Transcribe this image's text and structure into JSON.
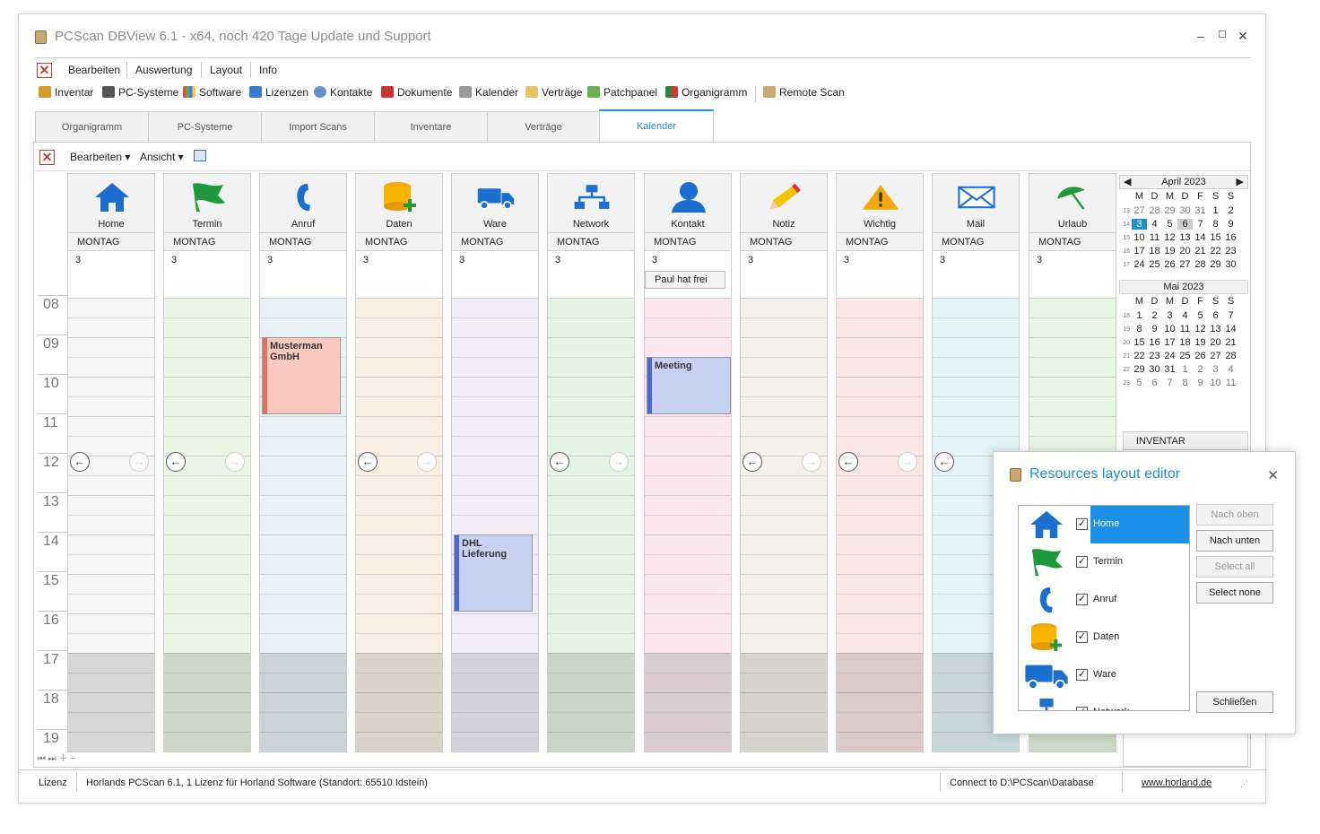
{
  "window": {
    "title": "PCScan DBView 6.1 - x64, noch 420 Tage Update und Support"
  },
  "menu": [
    "Bearbeiten",
    "Auswertung",
    "Layout",
    "Info"
  ],
  "toolbar": [
    "Inventar",
    "PC-Systeme",
    "Software",
    "Lizenzen",
    "Kontakte",
    "Dokumente",
    "Kalender",
    "Verträge",
    "Patchpanel",
    "Organigramm",
    "Remote Scan"
  ],
  "tabs": [
    "Organigramm",
    "PC-Systeme",
    "Import Scans",
    "Inventare",
    "Verträge",
    "Kalender"
  ],
  "subtoolbar": {
    "edit": "Bearbeiten ▾",
    "view": "Ansicht ▾"
  },
  "calendar": {
    "day_name": "MONTAG",
    "day_number": "3",
    "hours": [
      "08",
      "09",
      "10",
      "11",
      "12",
      "13",
      "14",
      "15",
      "16",
      "17",
      "18",
      "19"
    ],
    "resources": [
      {
        "name": "Home",
        "color": "#f5f5f5",
        "icon": "home-icon"
      },
      {
        "name": "Termin",
        "color": "#eaf5e4",
        "icon": "flag-icon"
      },
      {
        "name": "Anruf",
        "color": "#e6f2f6",
        "icon": "phone-icon"
      },
      {
        "name": "Daten",
        "color": "#fbeee2",
        "icon": "database-add-icon"
      },
      {
        "name": "Ware",
        "color": "#f1eefa",
        "icon": "truck-icon"
      },
      {
        "name": "Network",
        "color": "#e4f4e4",
        "icon": "network-icon"
      },
      {
        "name": "Kontakt",
        "color": "#fbe6ee",
        "icon": "contact-icon"
      },
      {
        "name": "Notiz",
        "color": "#f4f0ea",
        "icon": "pencil-icon"
      },
      {
        "name": "Wichtig",
        "color": "#fbe6e6",
        "icon": "warning-icon"
      },
      {
        "name": "Mail",
        "color": "#e2f4f8",
        "icon": "mail-icon"
      },
      {
        "name": "Urlaub",
        "color": "#e6f6e2",
        "icon": "umbrella-icon"
      }
    ],
    "allday_event": "Paul hat frei",
    "appointments": [
      {
        "title": "Musterman GmbH",
        "resource": "Anruf",
        "start": "09:00",
        "end": "11:00",
        "color": "#f9c9c0",
        "bar": "#e07060"
      },
      {
        "title": "Meeting",
        "resource": "Kontakt",
        "start": "09:30",
        "end": "11:00",
        "color": "#c7d2f2",
        "bar": "#4a68d0"
      },
      {
        "title": "DHL Lieferung",
        "resource": "Ware",
        "start": "14:00",
        "end": "16:00",
        "color": "#c7d2f2",
        "bar": "#4a68d0"
      }
    ]
  },
  "mini_calendars": [
    {
      "month": "April 2023",
      "weeks": [
        "13",
        "14",
        "15",
        "16",
        "17"
      ],
      "days": [
        [
          "27",
          "28",
          "29",
          "30",
          "31",
          "1",
          "2"
        ],
        [
          "3",
          "4",
          "5",
          "6",
          "7",
          "8",
          "9"
        ],
        [
          "10",
          "11",
          "12",
          "13",
          "14",
          "15",
          "16"
        ],
        [
          "17",
          "18",
          "19",
          "20",
          "21",
          "22",
          "23"
        ],
        [
          "24",
          "25",
          "26",
          "27",
          "28",
          "29",
          "30"
        ]
      ]
    },
    {
      "month": "Mai 2023",
      "weeks": [
        "18",
        "19",
        "20",
        "21",
        "22",
        "23"
      ],
      "days": [
        [
          "1",
          "2",
          "3",
          "4",
          "5",
          "6",
          "7"
        ],
        [
          "8",
          "9",
          "10",
          "11",
          "12",
          "13",
          "14"
        ],
        [
          "15",
          "16",
          "17",
          "18",
          "19",
          "20",
          "21"
        ],
        [
          "22",
          "23",
          "24",
          "25",
          "26",
          "27",
          "28"
        ],
        [
          "29",
          "30",
          "31",
          "1",
          "2",
          "3",
          "4"
        ],
        [
          "5",
          "6",
          "7",
          "8",
          "9",
          "10",
          "11"
        ]
      ]
    }
  ],
  "dow": [
    "M",
    "D",
    "M",
    "D",
    "F",
    "S",
    "S"
  ],
  "inventar_label": "INVENTAR",
  "status": {
    "lizenz": "Lizenz",
    "info": "Horlands PCScan 6.1, 1 Lizenz für Horland Software (Standort: 65510 Idstein)",
    "connect": "Connect to D:\\PCScan\\Database",
    "link": "www.horland.de"
  },
  "dialog": {
    "title": "Resources layout editor",
    "items": [
      "Home",
      "Termin",
      "Anruf",
      "Daten",
      "Ware",
      "Network"
    ],
    "buttons": {
      "up": "Nach oben",
      "down": "Nach unten",
      "all": "Select all",
      "none": "Select none",
      "close": "Schließen"
    }
  }
}
